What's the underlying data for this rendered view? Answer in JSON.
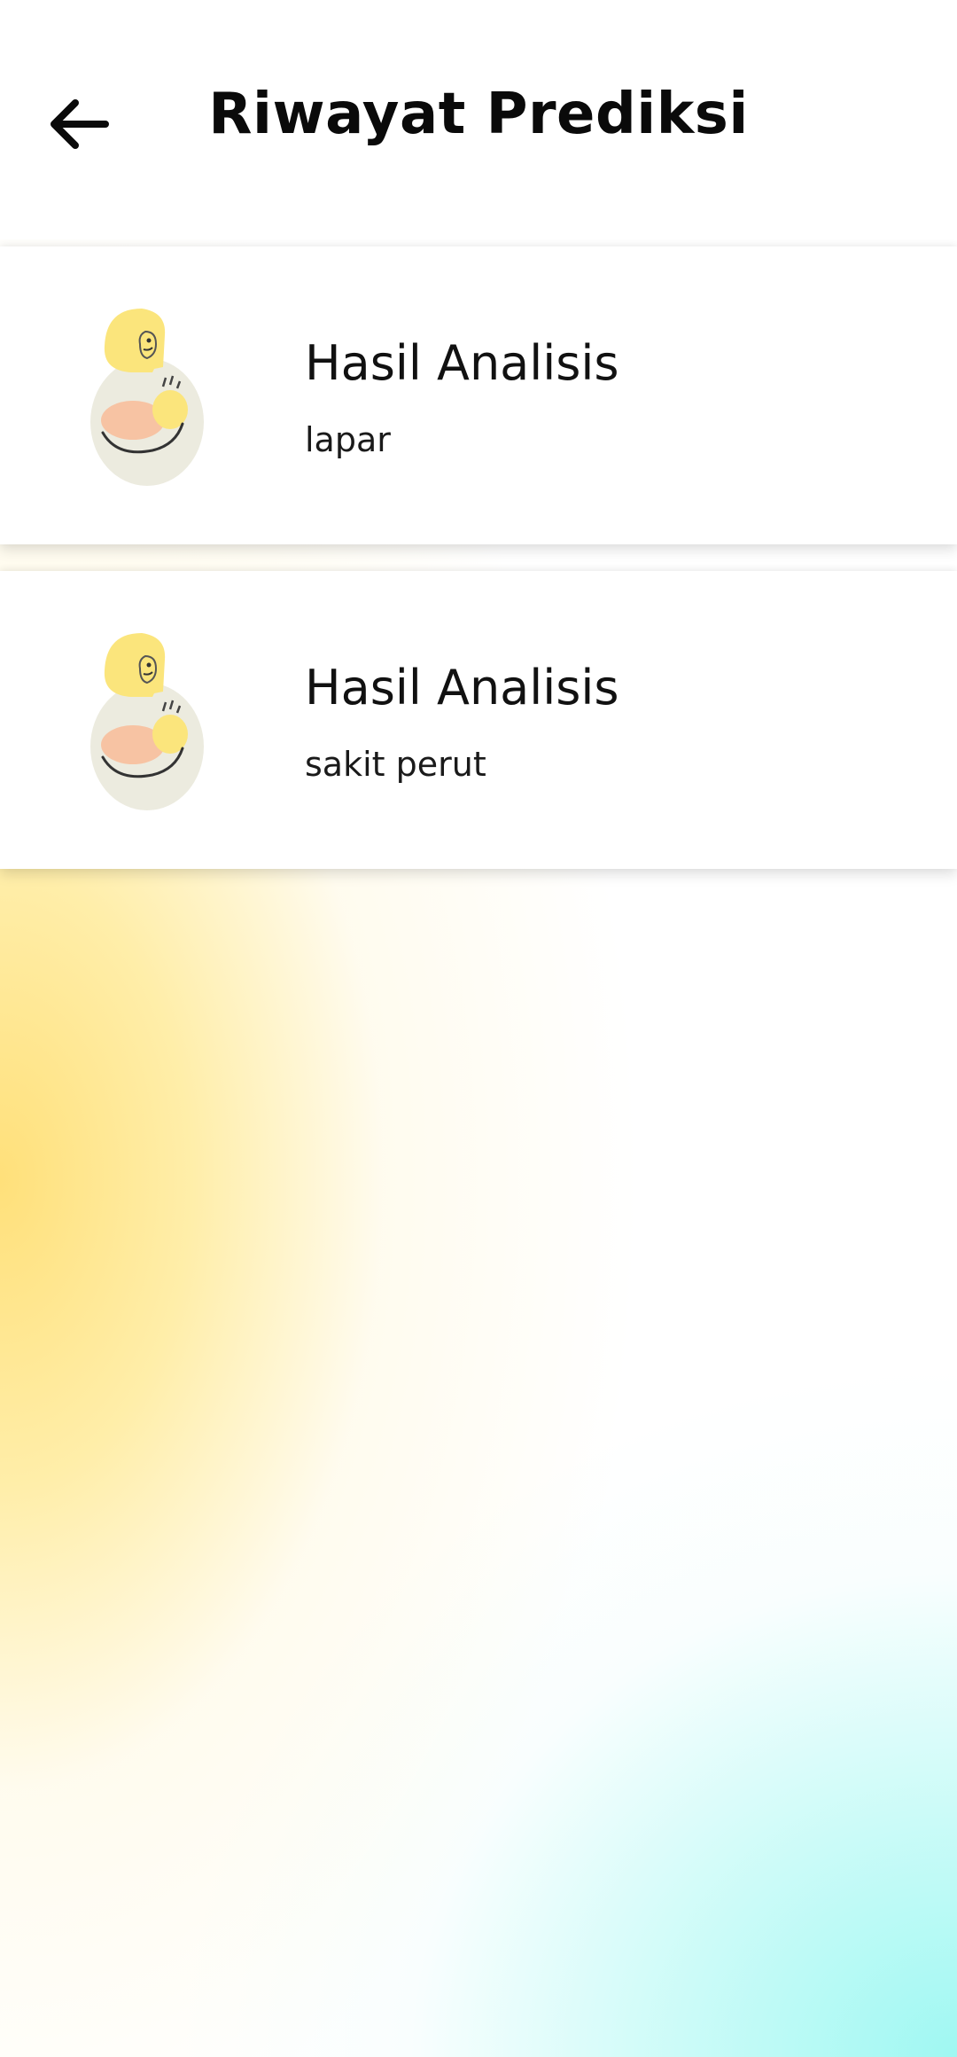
{
  "header": {
    "title": "Riwayat Prediksi",
    "back_icon": "arrow-left-icon"
  },
  "history": [
    {
      "title": "Hasil Analisis",
      "result": "lapar",
      "icon": "mother-baby-illustration"
    },
    {
      "title": "Hasil Analisis",
      "result": "sakit perut",
      "icon": "mother-baby-illustration"
    }
  ],
  "colors": {
    "accent_yellow": "#ffe07a",
    "accent_cyan": "#9ff8f2",
    "text": "#111111"
  }
}
